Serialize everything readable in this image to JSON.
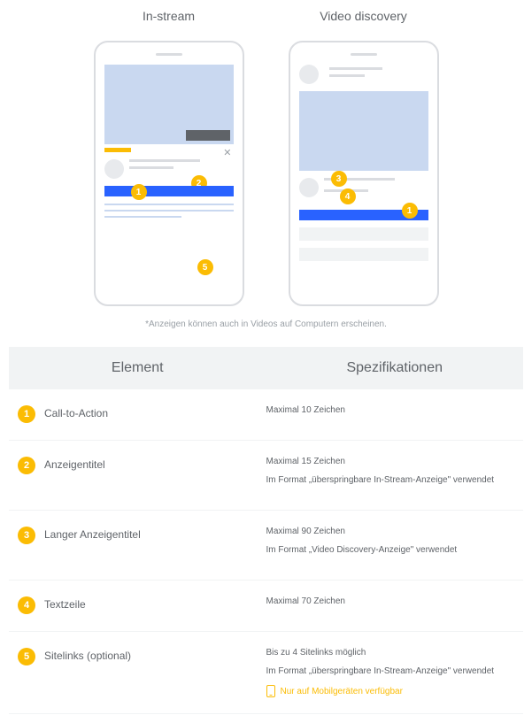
{
  "headers": {
    "instream": "In-stream",
    "discovery": "Video discovery"
  },
  "note": "*Anzeigen können auch in Videos auf Computern erscheinen.",
  "table": {
    "head": {
      "element": "Element",
      "spec": "Spezifikationen"
    },
    "rows": [
      {
        "num": "1",
        "label": "Call-to-Action",
        "specs": [
          "Maximal 10 Zeichen"
        ]
      },
      {
        "num": "2",
        "label": "Anzeigentitel",
        "specs": [
          "Maximal 15 Zeichen",
          "Im Format „überspringbare In-Stream-Anzeige\" verwendet"
        ]
      },
      {
        "num": "3",
        "label": "Langer Anzeigentitel",
        "specs": [
          "Maximal 90 Zeichen",
          "Im Format „Video Discovery-Anzeige\" verwendet"
        ]
      },
      {
        "num": "4",
        "label": "Textzeile",
        "specs": [
          "Maximal 70 Zeichen"
        ]
      },
      {
        "num": "5",
        "label": "Sitelinks (optional)",
        "specs": [
          "Bis zu 4 Sitelinks möglich",
          "Im Format „überspringbare In-Stream-Anzeige\" verwendet"
        ],
        "mobile": "Nur auf Mobilgeräten verfügbar"
      }
    ]
  },
  "markers": {
    "m1": "1",
    "m2": "2",
    "m3": "3",
    "m4": "4",
    "m5": "5"
  }
}
